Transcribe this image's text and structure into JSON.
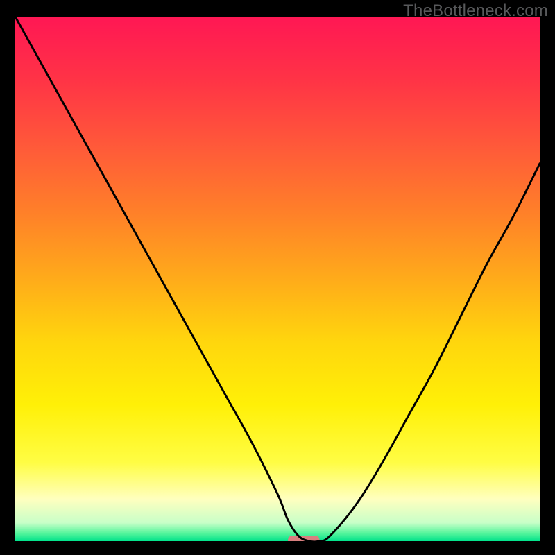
{
  "watermark": "TheBottleneck.com",
  "chart_data": {
    "type": "line",
    "title": "",
    "xlabel": "",
    "ylabel": "",
    "xlim": [
      0,
      100
    ],
    "ylim": [
      0,
      100
    ],
    "x": [
      0,
      5,
      10,
      15,
      20,
      25,
      30,
      35,
      40,
      45,
      50,
      52,
      54,
      56,
      58,
      60,
      65,
      70,
      75,
      80,
      85,
      90,
      95,
      100
    ],
    "values": [
      100,
      91,
      82,
      73,
      64,
      55,
      46,
      37,
      28,
      19,
      9,
      4,
      1,
      0,
      0,
      1,
      7,
      15,
      24,
      33,
      43,
      53,
      62,
      72
    ],
    "marker": {
      "x_start": 52,
      "x_end": 58,
      "y": 0,
      "color": "#d97f7f"
    },
    "background_gradient": [
      {
        "stop": 0.0,
        "color": "#ff1754"
      },
      {
        "stop": 0.12,
        "color": "#ff3346"
      },
      {
        "stop": 0.25,
        "color": "#ff5a39"
      },
      {
        "stop": 0.38,
        "color": "#ff8228"
      },
      {
        "stop": 0.5,
        "color": "#ffab1a"
      },
      {
        "stop": 0.62,
        "color": "#ffd60d"
      },
      {
        "stop": 0.74,
        "color": "#fff007"
      },
      {
        "stop": 0.85,
        "color": "#fffd44"
      },
      {
        "stop": 0.92,
        "color": "#ffffbf"
      },
      {
        "stop": 0.965,
        "color": "#c8ffc8"
      },
      {
        "stop": 0.985,
        "color": "#55f59c"
      },
      {
        "stop": 1.0,
        "color": "#00e28b"
      }
    ]
  }
}
